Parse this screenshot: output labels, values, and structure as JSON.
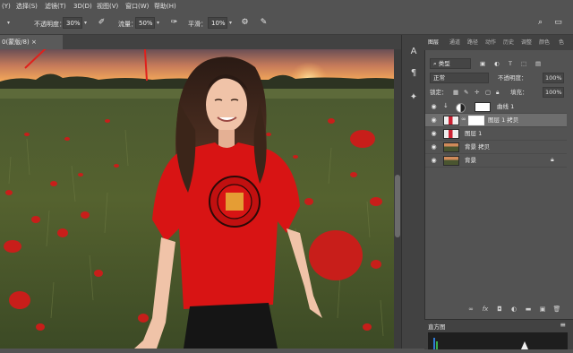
{
  "menubar": {
    "items": [
      "(Y)",
      "选择(S)",
      "滤镜(T)",
      "3D(D)",
      "视图(V)",
      "窗口(W)",
      "帮助(H)"
    ]
  },
  "options": {
    "opacity_label": "不透明度：",
    "opacity_value": "30%",
    "flow_label": "流量：",
    "flow_value": "50%",
    "smooth_label": "平滑：",
    "smooth_value": "10%"
  },
  "document": {
    "tab_title": "0(蒙版/8) ×"
  },
  "panel": {
    "tabs": [
      "图层",
      "通道",
      "路径",
      "动作",
      "历史",
      "调整",
      "颜色",
      "色"
    ],
    "kind_filter": "类型",
    "blend_mode": "正常",
    "opacity_label": "不透明度：",
    "opacity_value": "100%",
    "lock_label": "锁定：",
    "fill_label": "填充：",
    "fill_value": "100%",
    "layers": [
      {
        "name": "曲线 1"
      },
      {
        "name": "图层 1 拷贝"
      },
      {
        "name": "图层 1"
      },
      {
        "name": "背景 拷贝"
      },
      {
        "name": "背景"
      }
    ],
    "bottom_icons": [
      "link-icon",
      "fx-icon",
      "mask-icon",
      "adjustment-icon",
      "group-icon",
      "new-layer-icon",
      "delete-icon"
    ]
  },
  "histogram": {
    "tab_label": "直方图"
  },
  "colors": {
    "arrow_red": "#e0201c",
    "shirt_red": "#d81414"
  }
}
